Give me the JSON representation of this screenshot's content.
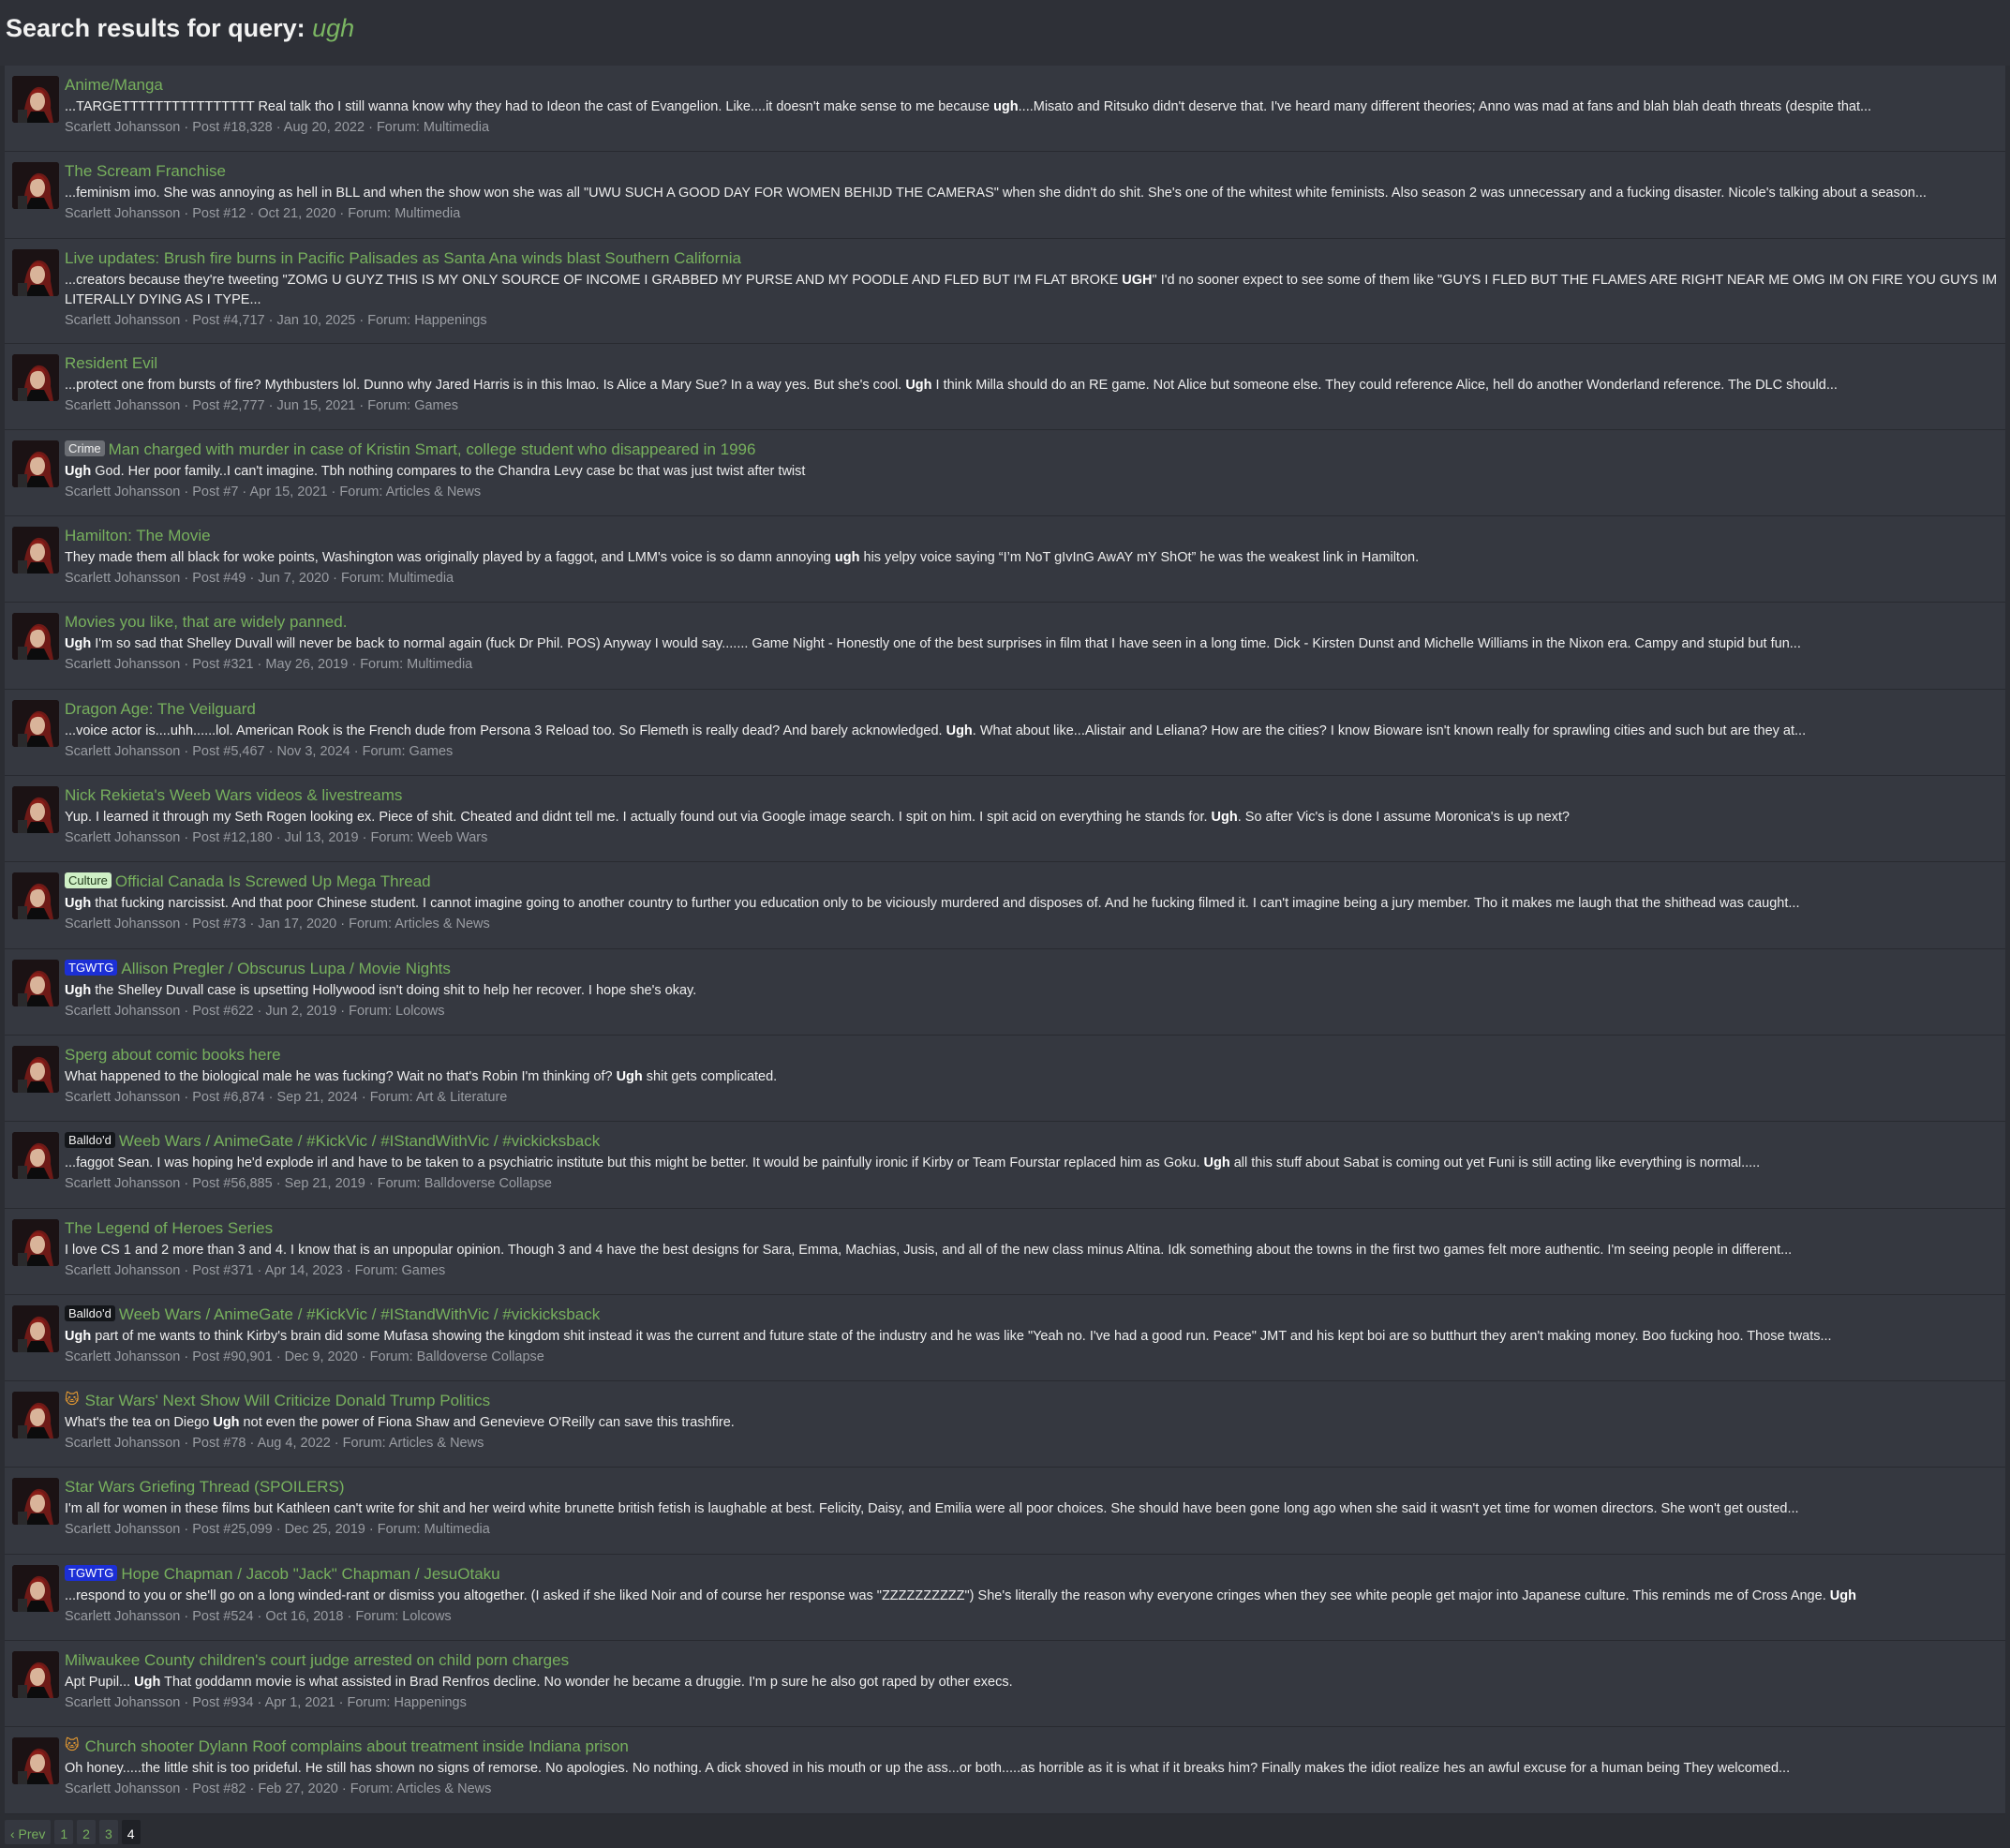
{
  "header": {
    "title_prefix": "Search results for query:",
    "query": "ugh"
  },
  "results": [
    {
      "prefix": "",
      "title": "Anime/Manga",
      "pre": "...TARGETTTTTTTTTTTTTTTT Real talk tho I still wanna know why they had to Ideon the cast of Evangelion. Like....it doesn't make sense to me because ",
      "hl": "ugh",
      "post": "....Misato and Ritsuko didn't deserve that. I've heard many different theories; Anno was mad at fans and blah blah death threats (despite that...",
      "author": "Scarlett Johansson",
      "post_no": "Post #18,328",
      "date": "Aug 20, 2022",
      "forum": "Forum: Multimedia"
    },
    {
      "prefix": "",
      "title": "The Scream Franchise",
      "pre": "...feminism imo. She was annoying as hell in BLL and when the show won she was all \"UWU SUCH A GOOD DAY FOR WOMEN BEHIJD THE CAMERAS\" when she didn't do shit. She's one of the whitest white feminists. Also season 2 was unnecessary and a fucking disaster. Nicole's talking about a season...",
      "hl": "",
      "post": "",
      "author": "Scarlett Johansson",
      "post_no": "Post #12",
      "date": "Oct 21, 2020",
      "forum": "Forum: Multimedia"
    },
    {
      "prefix": "",
      "title": "Live updates: Brush fire burns in Pacific Palisades as Santa Ana winds blast Southern California",
      "pre": "...creators because they're tweeting \"ZOMG U GUYZ THIS IS MY ONLY SOURCE OF INCOME I GRABBED MY PURSE AND MY POODLE AND FLED BUT I'M FLAT BROKE ",
      "hl": "UGH",
      "post": "\" I'd no sooner expect to see some of them like \"GUYS I FLED BUT THE FLAMES ARE RIGHT NEAR ME OMG IM ON FIRE YOU GUYS IM LITERALLY DYING AS I TYPE...",
      "author": "Scarlett Johansson",
      "post_no": "Post #4,717",
      "date": "Jan 10, 2025",
      "forum": "Forum: Happenings"
    },
    {
      "prefix": "",
      "title": "Resident Evil",
      "pre": "...protect one from bursts of fire? Mythbusters lol. Dunno why Jared Harris is in this lmao. Is Alice a Mary Sue? In a way yes. But she's cool. ",
      "hl": "Ugh",
      "post": " I think Milla should do an RE game. Not Alice but someone else. They could reference Alice, hell do another Wonderland reference. The DLC should...",
      "author": "Scarlett Johansson",
      "post_no": "Post #2,777",
      "date": "Jun 15, 2021",
      "forum": "Forum: Games"
    },
    {
      "prefix": "Crime",
      "prefix_kind": "crime",
      "title": "Man charged with murder in case of Kristin Smart, college student who disappeared in 1996",
      "pre": "",
      "hl": "Ugh",
      "post": " God. Her poor family..I can't imagine. Tbh nothing compares to the Chandra Levy case bc that was just twist after twist",
      "author": "Scarlett Johansson",
      "post_no": "Post #7",
      "date": "Apr 15, 2021",
      "forum": "Forum: Articles & News"
    },
    {
      "prefix": "",
      "title": "Hamilton: The Movie",
      "pre": "They made them all black for woke points, Washington was originally played by a faggot, and LMM's voice is so damn annoying ",
      "hl": "ugh",
      "post": " his yelpy voice saying “I’m NoT gIvInG AwAY mY ShOt” he was the weakest link in Hamilton.",
      "author": "Scarlett Johansson",
      "post_no": "Post #49",
      "date": "Jun 7, 2020",
      "forum": "Forum: Multimedia"
    },
    {
      "prefix": "",
      "title": "Movies you like, that are widely panned.",
      "pre": "",
      "hl": "Ugh",
      "post": " I'm so sad that Shelley Duvall will never be back to normal again (fuck Dr Phil. POS) Anyway I would say....... Game Night - Honestly one of the best surprises in film that I have seen in a long time. Dick - Kirsten Dunst and Michelle Williams in the Nixon era. Campy and stupid but fun...",
      "author": "Scarlett Johansson",
      "post_no": "Post #321",
      "date": "May 26, 2019",
      "forum": "Forum: Multimedia"
    },
    {
      "prefix": "",
      "title": "Dragon Age: The Veilguard",
      "pre": "...voice actor is....uhh......lol. American Rook is the French dude from Persona 3 Reload too. So Flemeth is really dead? And barely acknowledged. ",
      "hl": "Ugh",
      "post": ". What about like...Alistair and Leliana? How are the cities? I know Bioware isn't known really for sprawling cities and such but are they at...",
      "author": "Scarlett Johansson",
      "post_no": "Post #5,467",
      "date": "Nov 3, 2024",
      "forum": "Forum: Games"
    },
    {
      "prefix": "",
      "title": "Nick Rekieta's Weeb Wars videos & livestreams",
      "pre": "Yup. I learned it through my Seth Rogen looking ex. Piece of shit. Cheated and didnt tell me. I actually found out via Google image search. I spit on him. I spit acid on everything he stands for. ",
      "hl": "Ugh",
      "post": ". So after Vic's is done I assume Moronica's is up next?",
      "author": "Scarlett Johansson",
      "post_no": "Post #12,180",
      "date": "Jul 13, 2019",
      "forum": "Forum: Weeb Wars"
    },
    {
      "prefix": "Culture",
      "prefix_kind": "culture",
      "title": "Official Canada Is Screwed Up Mega Thread",
      "pre": "",
      "hl": "Ugh",
      "post": " that fucking narcissist. And that poor Chinese student. I cannot imagine going to another country to further you education only to be viciously murdered and disposes of. And he fucking filmed it. I can't imagine being a jury member. Tho it makes me laugh that the shithead was caught...",
      "author": "Scarlett Johansson",
      "post_no": "Post #73",
      "date": "Jan 17, 2020",
      "forum": "Forum: Articles & News"
    },
    {
      "prefix": "TGWTG",
      "prefix_kind": "tgwtg",
      "title": "Allison Pregler / Obscurus Lupa / Movie Nights",
      "pre": "",
      "hl": "Ugh",
      "post": " the Shelley Duvall case is upsetting Hollywood isn't doing shit to help her recover. I hope she's okay.",
      "author": "Scarlett Johansson",
      "post_no": "Post #622",
      "date": "Jun 2, 2019",
      "forum": "Forum: Lolcows"
    },
    {
      "prefix": "",
      "title": "Sperg about comic books here",
      "pre": "What happened to the biological male he was fucking? Wait no that's Robin I'm thinking of? ",
      "hl": "Ugh",
      "post": " shit gets complicated.",
      "author": "Scarlett Johansson",
      "post_no": "Post #6,874",
      "date": "Sep 21, 2024",
      "forum": "Forum: Art & Literature"
    },
    {
      "prefix": "Balldo'd",
      "prefix_kind": "balldod",
      "title": "Weeb Wars / AnimeGate / #KickVic / #IStandWithVic / #vickicksback",
      "pre": "...faggot Sean. I was hoping he'd explode irl and have to be taken to a psychiatric institute but this might be better. It would be painfully ironic if Kirby or Team Fourstar replaced him as Goku. ",
      "hl": "Ugh",
      "post": " all this stuff about Sabat is coming out yet Funi is still acting like everything is normal.....",
      "author": "Scarlett Johansson",
      "post_no": "Post #56,885",
      "date": "Sep 21, 2019",
      "forum": "Forum: Balldoverse Collapse"
    },
    {
      "prefix": "",
      "title": "The Legend of Heroes Series",
      "pre": "I love CS 1 and 2 more than 3 and 4. I know that is an unpopular opinion. Though 3 and 4 have the best designs for Sara, Emma, Machias, Jusis, and all of the new class minus Altina. Idk something about the towns in the first two games felt more authentic. I'm seeing people in different...",
      "hl": "",
      "post": "",
      "author": "Scarlett Johansson",
      "post_no": "Post #371",
      "date": "Apr 14, 2023",
      "forum": "Forum: Games"
    },
    {
      "prefix": "Balldo'd",
      "prefix_kind": "balldod",
      "title": "Weeb Wars / AnimeGate / #KickVic / #IStandWithVic / #vickicksback",
      "pre": "",
      "hl": "Ugh",
      "post": " part of me wants to think Kirby's brain did some Mufasa showing the kingdom shit instead it was the current and future state of the industry and he was like \"Yeah no. I've had a good run. Peace\" JMT and his kept boi are so butthurt they aren't making money. Boo fucking hoo. Those twats...",
      "author": "Scarlett Johansson",
      "post_no": "Post #90,901",
      "date": "Dec 9, 2020",
      "forum": "Forum: Balldoverse Collapse"
    },
    {
      "prefix": "🐱",
      "prefix_kind": "cat",
      "title": "Star Wars' Next Show Will Criticize Donald Trump Politics",
      "pre": "What's the tea on Diego ",
      "hl": "Ugh",
      "post": " not even the power of Fiona Shaw and Genevieve O'Reilly can save this trashfire.",
      "author": "Scarlett Johansson",
      "post_no": "Post #78",
      "date": "Aug 4, 2022",
      "forum": "Forum: Articles & News"
    },
    {
      "prefix": "",
      "title": "Star Wars Griefing Thread (SPOILERS)",
      "pre": "I'm all for women in these films but Kathleen can't write for shit and her weird white brunette british fetish is laughable at best. Felicity, Daisy, and Emilia were all poor choices. She should have been gone long ago when she said it wasn't yet time for women directors. She won't get ousted...",
      "hl": "",
      "post": "",
      "author": "Scarlett Johansson",
      "post_no": "Post #25,099",
      "date": "Dec 25, 2019",
      "forum": "Forum: Multimedia"
    },
    {
      "prefix": "TGWTG",
      "prefix_kind": "tgwtg",
      "title": "Hope Chapman / Jacob \"Jack\" Chapman / JesuOtaku",
      "pre": "...respond to you or she'll go on a long winded-rant or dismiss you altogether. (I asked if she liked Noir and of course her response was \"ZZZZZZZZZZ\") She's literally the reason why everyone cringes when they see white people get major into Japanese culture. This reminds me of Cross Ange. ",
      "hl": "Ugh",
      "post": "",
      "author": "Scarlett Johansson",
      "post_no": "Post #524",
      "date": "Oct 16, 2018",
      "forum": "Forum: Lolcows"
    },
    {
      "prefix": "",
      "title": "Milwaukee County children's court judge arrested on child porn charges",
      "pre": "Apt Pupil... ",
      "hl": "Ugh",
      "post": " That goddamn movie is what assisted in Brad Renfros decline. No wonder he became a druggie. I'm p sure he also got raped by other execs.",
      "author": "Scarlett Johansson",
      "post_no": "Post #934",
      "date": "Apr 1, 2021",
      "forum": "Forum: Happenings"
    },
    {
      "prefix": "🐱",
      "prefix_kind": "cat",
      "title": "Church shooter Dylann Roof complains about treatment inside Indiana prison",
      "pre": "Oh honey.....the little shit is too prideful. He still has shown no signs of remorse. No apologies. No nothing. A dick shoved in his mouth or up the ass...or both.....as horrible as it is what if it breaks him? Finally makes the idiot realize hes an awful excuse for a human being They welcomed...",
      "hl": "",
      "post": "",
      "author": "Scarlett Johansson",
      "post_no": "Post #82",
      "date": "Feb 27, 2020",
      "forum": "Forum: Articles & News"
    }
  ],
  "pagination": {
    "prev": "‹ Prev",
    "pages": [
      "1",
      "2",
      "3",
      "4"
    ],
    "current": "4"
  },
  "colors": {
    "accent_green": "#77b05d",
    "background": "#2b2d33",
    "row_background": "#353840"
  },
  "icons": {
    "avatar": "user-avatar-icon"
  }
}
